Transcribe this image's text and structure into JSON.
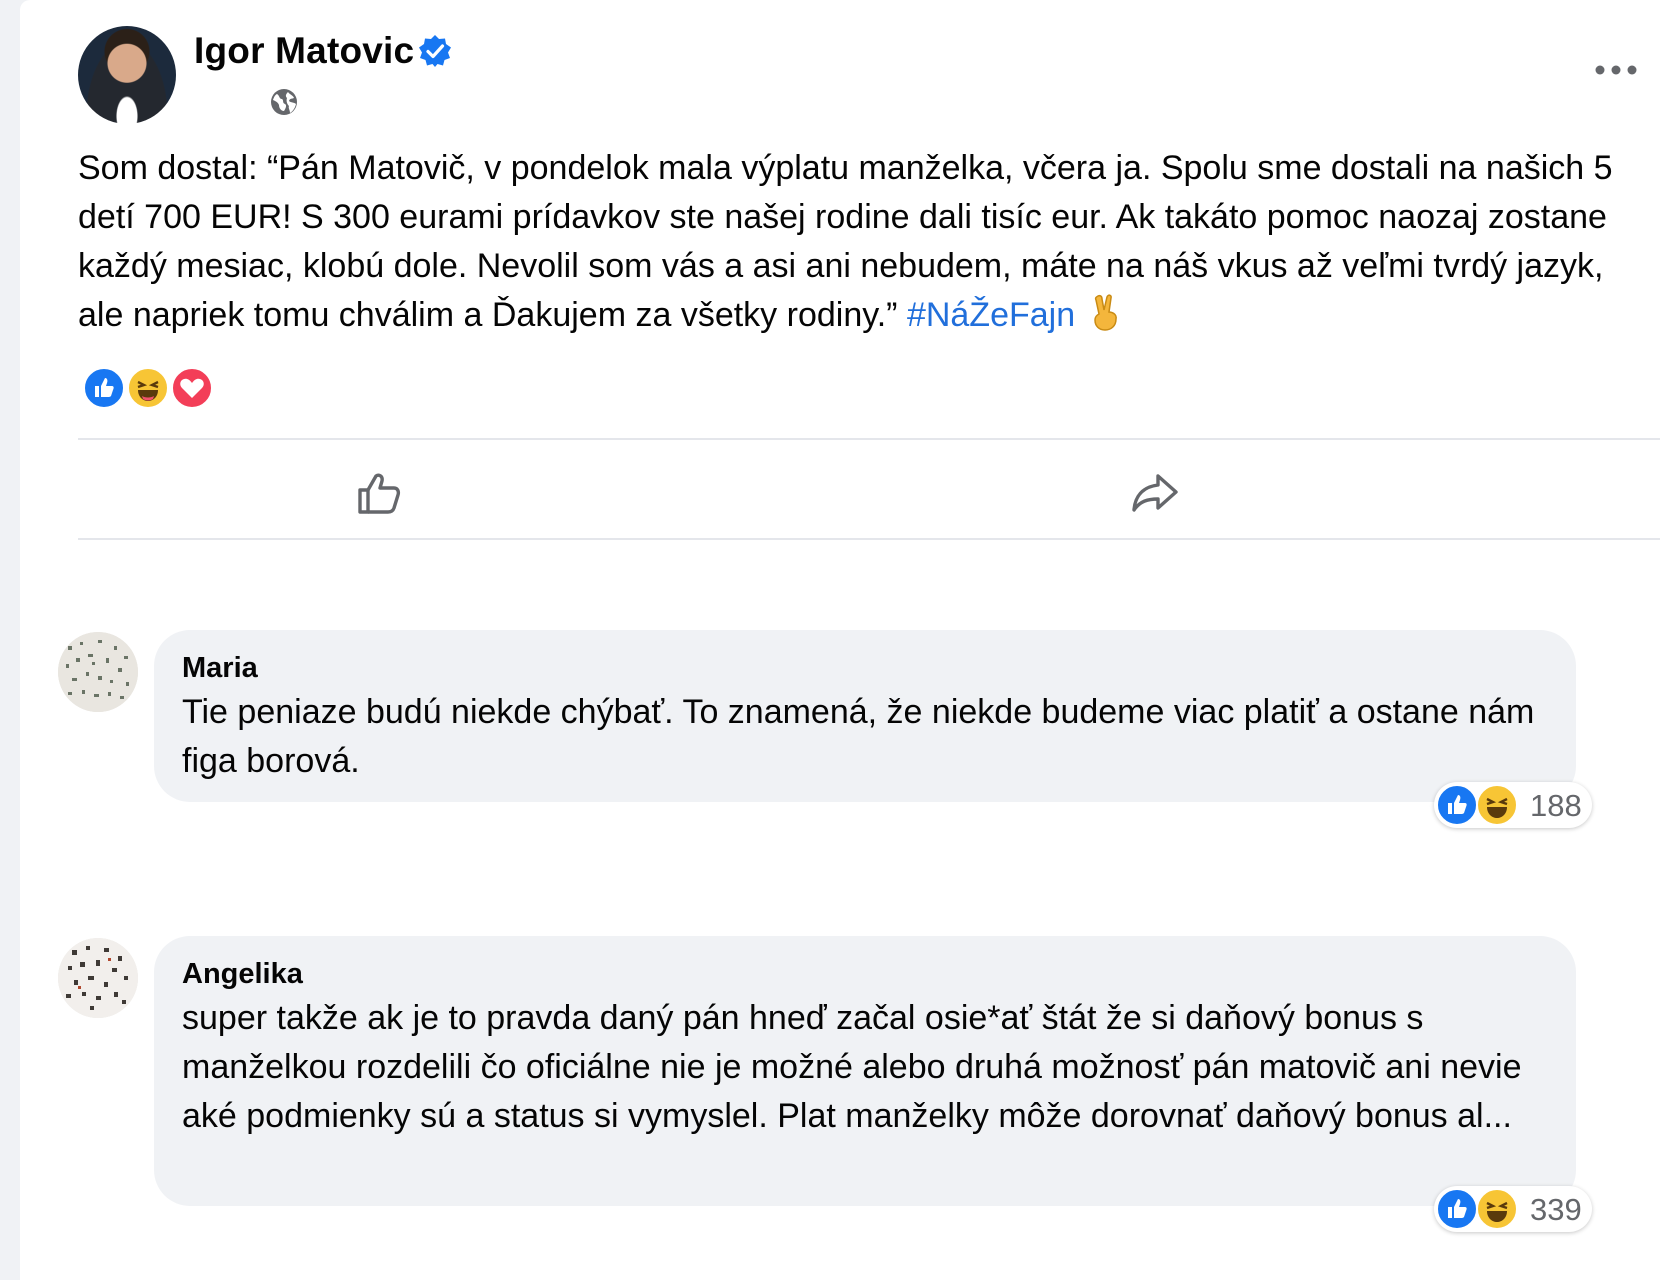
{
  "post": {
    "author": "Igor Matovic",
    "text": "Som dostal: “Pán Matovič, v pondelok mala výplatu manželka, včera ja. Spolu sme dostali na našich 5 detí 700 EUR! S 300 eurami prídavkov ste našej rodine dali tisíc eur. Ak takáto pomoc naozaj zostane každý mesiac, klobú dole. Nevolil som vás a asi ani nebudem, máte na náš vkus až veľmi tvrdý jazyk, ale napriek tomu chválim a Ďakujem za všetky rodiny.”",
    "hashtag": "#NáŽeFajn",
    "reactions": [
      "like",
      "haha",
      "love"
    ],
    "icons": {
      "verified": "verified-badge-icon",
      "audience": "globe-icon",
      "menu": "more-options-icon",
      "like": "like-icon",
      "share": "share-icon"
    }
  },
  "comments": [
    {
      "name": "Maria",
      "text": "Tie peniaze budú niekde chýbať. To znamená, že niekde budeme viac platiť a ostane nám figa borová.",
      "reactions": [
        "like",
        "haha"
      ],
      "count": "188"
    },
    {
      "name": "Angelika",
      "text": "super takže ak je to pravda daný pán hneď začal osie*ať štát že si daňový bonus s manželkou rozdelili čo oficiálne nie je možné alebo druhá možnosť pán matovič ani nevie aké podmienky sú a status si vymyslel. Plat manželky môže dorovnať daňový bonus al...",
      "reactions": [
        "like",
        "haha"
      ],
      "count": "339"
    }
  ],
  "colors": {
    "background": "#f0f2f5",
    "card": "#ffffff",
    "link": "#216fdb",
    "like": "#1877f2",
    "haha": "#f7c535",
    "love": "#f33e58",
    "secondary_text": "#65676b"
  }
}
